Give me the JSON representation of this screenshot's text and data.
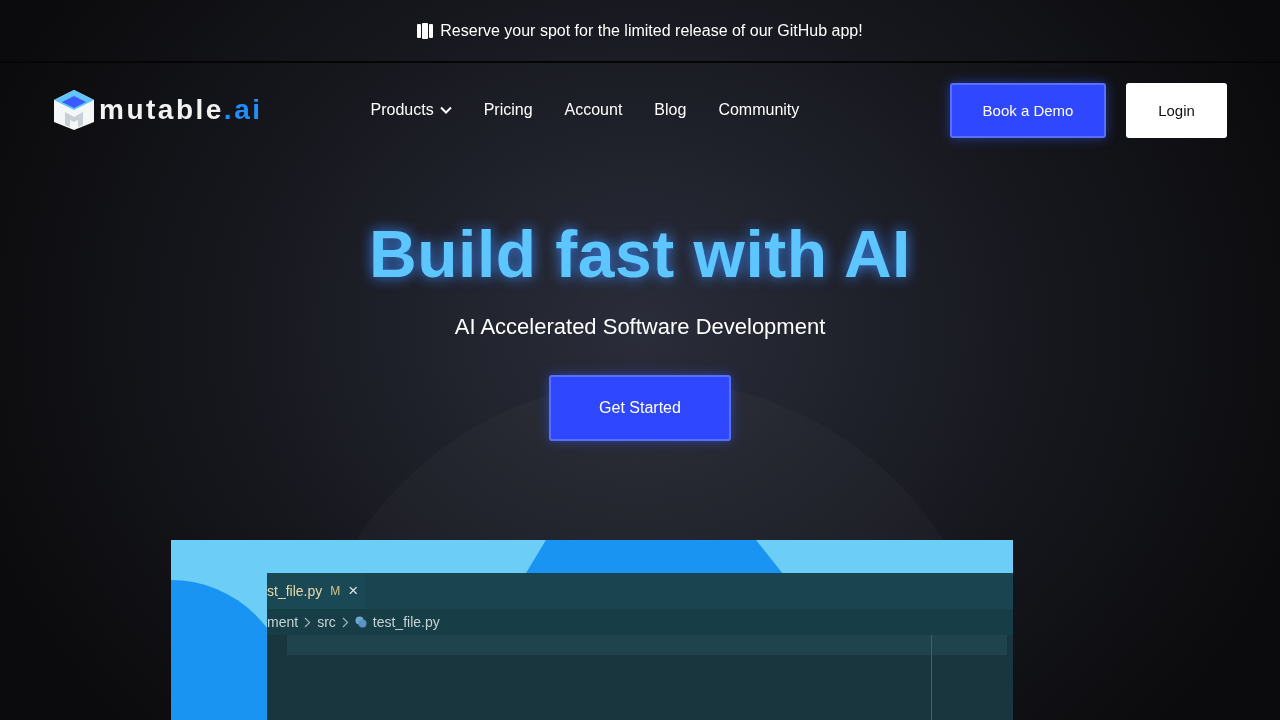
{
  "announcement": {
    "text": "Reserve your spot for the limited release of our GitHub app!"
  },
  "logo": {
    "name": "mutable",
    "suffix": ".ai"
  },
  "nav": {
    "items": [
      {
        "label": "Products",
        "dropdown": true
      },
      {
        "label": "Pricing",
        "dropdown": false
      },
      {
        "label": "Account",
        "dropdown": false
      },
      {
        "label": "Blog",
        "dropdown": false
      },
      {
        "label": "Community",
        "dropdown": false
      }
    ],
    "buttons": [
      {
        "label": "Book a Demo",
        "kind": "primary"
      },
      {
        "label": "Login",
        "kind": "secondary"
      }
    ]
  },
  "hero": {
    "title": "Build fast with AI",
    "subtitle": "AI Accelerated Software Development",
    "cta": "Get Started"
  },
  "editor": {
    "tab": {
      "filename": "st_file.py",
      "status": "M",
      "close": "×"
    },
    "breadcrumbs": [
      "ment",
      "src",
      "test_file.py"
    ]
  }
}
